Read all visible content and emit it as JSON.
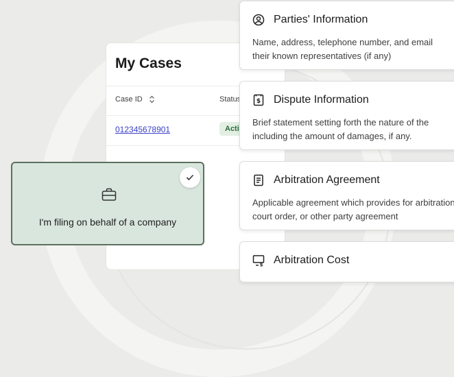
{
  "cases": {
    "title": "My Cases",
    "columns": [
      "Case ID",
      "Status"
    ],
    "rows": [
      {
        "case_id": "012345678901",
        "status": "Active"
      }
    ]
  },
  "company_option": {
    "label": "I'm filing on behalf of a company",
    "selected": true
  },
  "info_cards": [
    {
      "title": "Parties' Information",
      "icon": "user-circle-icon",
      "desc_line1": "Name, address, telephone number, and email",
      "desc_line2": "their known representatives (if any)"
    },
    {
      "title": "Dispute Information",
      "icon": "receipt-dollar-icon",
      "desc_line1": "Brief statement setting forth the nature of the",
      "desc_line2": "including the amount of damages, if any."
    },
    {
      "title": "Arbitration Agreement",
      "icon": "document-icon",
      "desc_line1": "Applicable agreement which provides for arbitration",
      "desc_line2": "court order, or other party agreement"
    },
    {
      "title": "Arbitration Cost",
      "icon": "monitor-dollar-icon"
    }
  ]
}
